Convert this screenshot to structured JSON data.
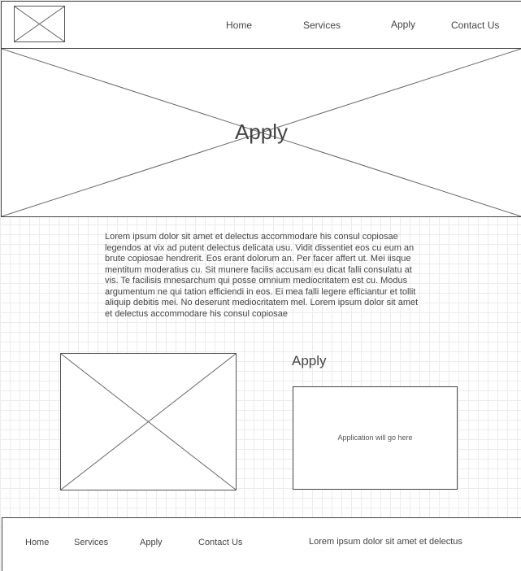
{
  "header": {
    "logo_icon": "logo-placeholder-image",
    "nav": [
      "Home",
      "Services",
      "Apply",
      "Contact Us"
    ]
  },
  "hero": {
    "title": "Apply",
    "image_icon": "hero-placeholder-image"
  },
  "intro": {
    "text": "Lorem ipsum dolor sit amet et delectus accommodare his consul copiosae legendos at vix ad putent delectus delicata usu. Vidit dissentiet eos cu eum an brute copiosae hendrerit. Eos erant dolorum an. Per facer affert ut. Mei iisque mentitum moderatius cu. Sit munere facilis accusam eu dicat falli consulatu at vis. Te facilisis mnesarchum qui posse omnium mediocritatem est cu. Modus argumentum ne qui tation efficiendi in eos. Ei mea falli legere efficiantur et tollit aliquip debitis mei. No deserunt mediocritatem mel. Lorem ipsum dolor sit amet et delectus accommodare his consul copiosae"
  },
  "content": {
    "side_title": "Apply",
    "application_placeholder": "Application will go here",
    "image_icon": "content-placeholder-image"
  },
  "footer": {
    "nav": [
      "Home",
      "Services",
      "Apply",
      "Contact Us"
    ],
    "text": "Lorem ipsum dolor sit amet et delectus"
  }
}
